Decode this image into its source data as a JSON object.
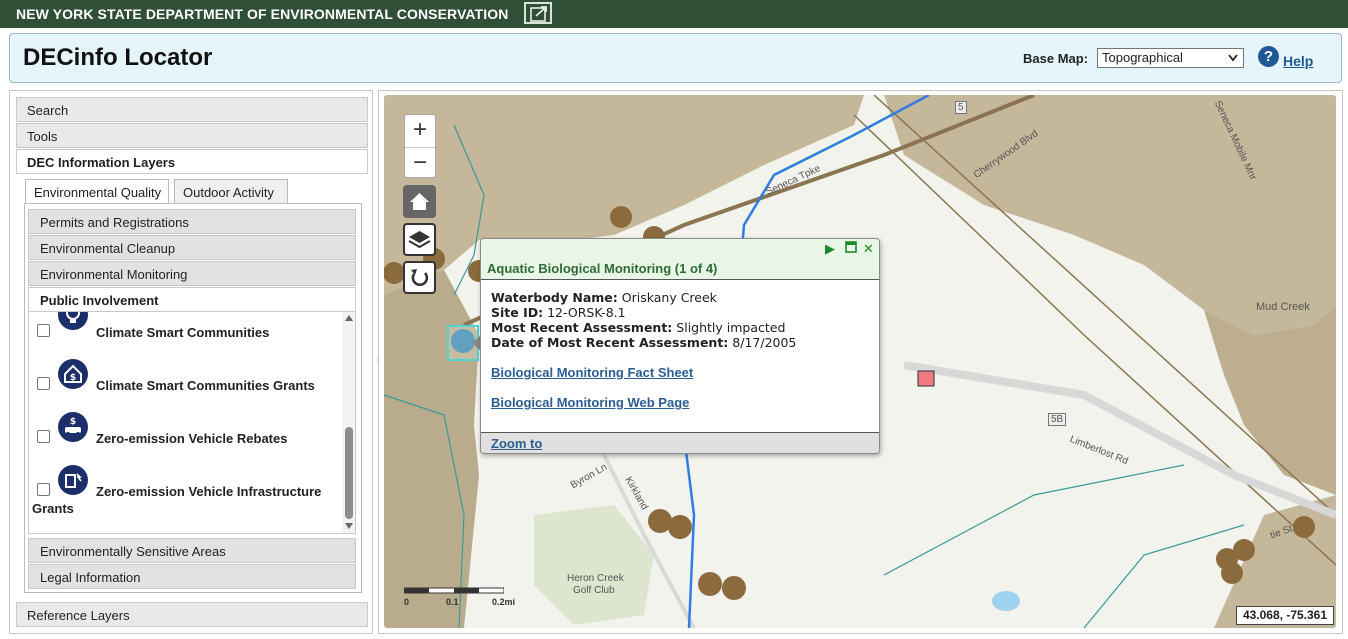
{
  "agency": {
    "title": "NEW YORK STATE DEPARTMENT OF ENVIRONMENTAL CONSERVATION",
    "icon": "external-link-icon"
  },
  "header": {
    "app_title": "DECinfo Locator",
    "basemap_label": "Base Map:",
    "basemap_selected": "Topographical",
    "help_icon": "?",
    "help_label": "Help"
  },
  "left_panel": {
    "sections": {
      "search": "Search",
      "tools": "Tools",
      "dec_layers": "DEC Information Layers",
      "reference_layers": "Reference Layers"
    },
    "tabs": [
      "Environmental Quality",
      "Outdoor Activity"
    ],
    "subsections": {
      "permits": "Permits and Registrations",
      "cleanup": "Environmental Cleanup",
      "monitoring": "Environmental Monitoring",
      "public": "Public Involvement",
      "sensitive": "Environmentally Sensitive Areas",
      "legal": "Legal Information"
    },
    "layers": [
      {
        "label": "Climate Smart Communities",
        "icon": "lightbulb-icon",
        "checked": false
      },
      {
        "label": "Climate Smart Communities Grants",
        "icon": "dollar-house-icon",
        "checked": false
      },
      {
        "label": "Zero-emission Vehicle Rebates",
        "icon": "car-dollar-icon",
        "checked": false
      },
      {
        "label": "Zero-emission Vehicle Infrastructure",
        "label_cont": "Grants",
        "icon": "ev-charger-icon",
        "checked": false
      }
    ]
  },
  "map": {
    "zoom_in": "+",
    "zoom_out": "−",
    "coords": "43.068, -75.361",
    "scale": {
      "l0": "0",
      "l1": "0.1",
      "l2": "0.2mi"
    },
    "road_labels": {
      "seneca_tpke": "Seneca Tpke",
      "mud_creek": "Mud Creek",
      "byron_ln": "Byron Ln",
      "kirkland": "Kirkland",
      "limberlost_rd": "Limberlost Rd",
      "heron_creek_1": "Heron Creek",
      "heron_creek_2": "Golf Club",
      "cherrywood": "Cherrywood Blvd",
      "route_5": "5",
      "route_5b": "5B",
      "seneca_mobile": "Seneca Mobile Mnr",
      "tie_st": "tie St"
    },
    "popup": {
      "title": "Aquatic Biological Monitoring (1 of 4)",
      "fields": [
        {
          "label": "Waterbody Name:",
          "value": "Oriskany Creek"
        },
        {
          "label": "Site ID:",
          "value": "12-ORSK-8.1"
        },
        {
          "label": "Most Recent Assessment:",
          "value": "Slightly impacted"
        },
        {
          "label": "Date of Most Recent Assessment:",
          "value": "8/17/2005"
        }
      ],
      "link1": "Biological Monitoring Fact Sheet",
      "link2": "Biological Monitoring Web Page",
      "zoom_to": "Zoom to"
    }
  }
}
